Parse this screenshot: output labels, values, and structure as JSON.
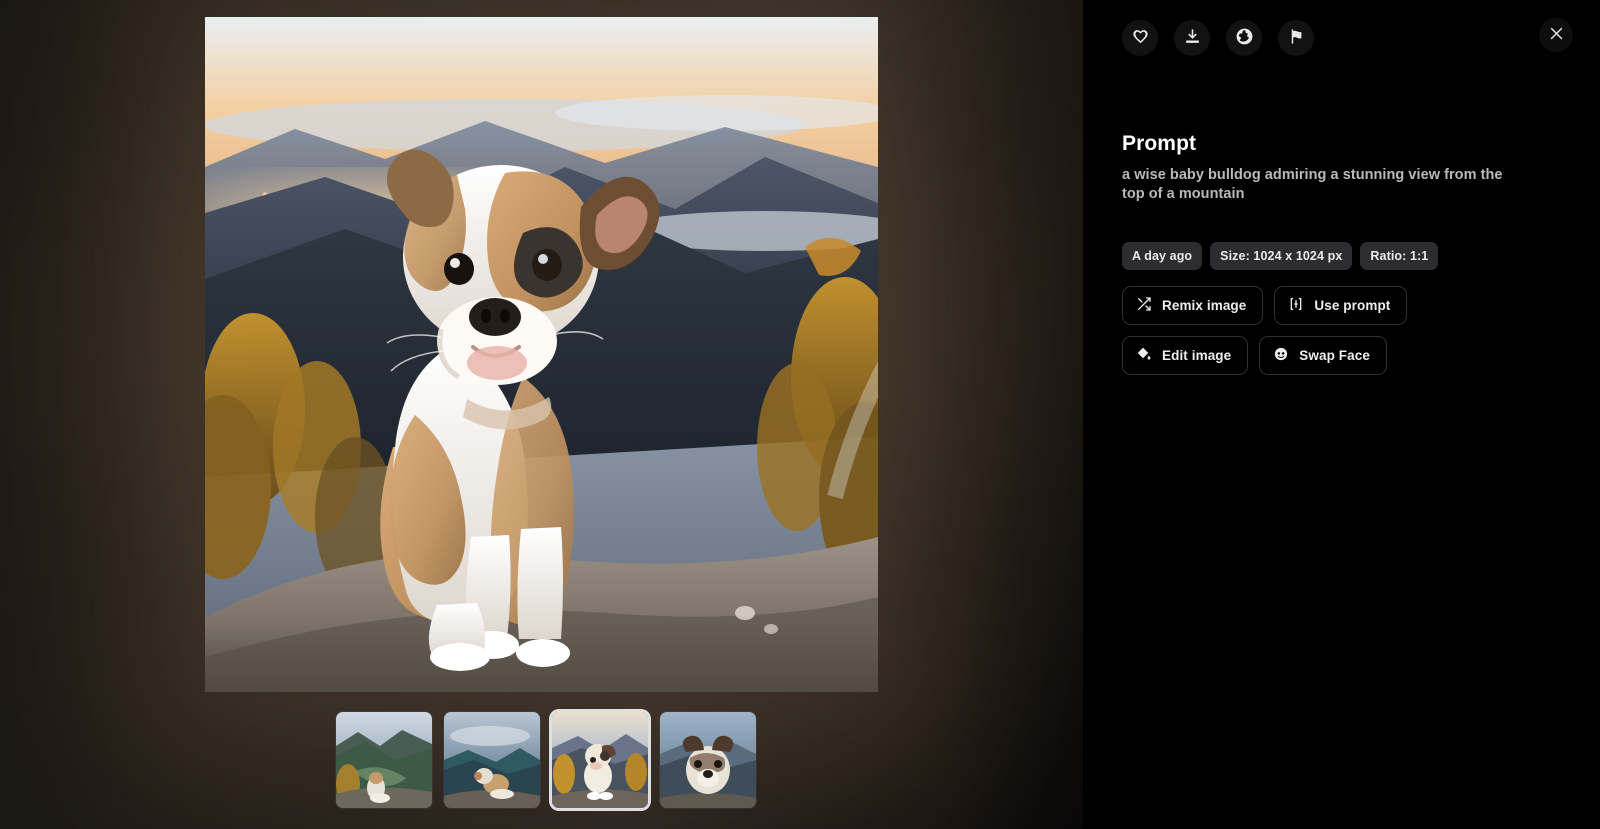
{
  "viewer": {
    "main_image_alt": "a wise baby bulldog sitting on a rocky mountain ledge at sunset",
    "thumbnails": [
      {
        "alt": "bulldog puppy sitting on mountain overlook with green valley",
        "selected": false
      },
      {
        "alt": "bulldog puppy in profile on rock with blue mountain range",
        "selected": false
      },
      {
        "alt": "bulldog puppy standing on rock with autumn trees",
        "selected": true
      },
      {
        "alt": "close up bulldog puppy face against mountain sky",
        "selected": false
      }
    ]
  },
  "toolbar": {
    "buttons": [
      {
        "name": "favorite",
        "icon": "heart-icon",
        "label": "Favorite"
      },
      {
        "name": "download",
        "icon": "download-icon",
        "label": "Download"
      },
      {
        "name": "publish",
        "icon": "globe-icon",
        "label": "Make public"
      },
      {
        "name": "report",
        "icon": "flag-icon",
        "label": "Report"
      }
    ],
    "close": {
      "icon": "close-icon",
      "label": "Close"
    }
  },
  "details": {
    "title": "Prompt",
    "prompt": "a wise baby bulldog admiring a stunning view from the top of a mountain",
    "chips": [
      "A day ago",
      "Size: 1024 x 1024 px",
      "Ratio: 1:1"
    ],
    "actions": [
      {
        "label": "Remix image",
        "icon": "shuffle-icon"
      },
      {
        "label": "Use prompt",
        "icon": "text-cursor-icon"
      },
      {
        "label": "Edit image",
        "icon": "paint-bucket-icon"
      },
      {
        "label": "Swap Face",
        "icon": "face-icon"
      }
    ]
  },
  "colors": {
    "panel_bg": "#000000",
    "viewer_bg": "#241f1a",
    "chip_bg": "#2c2c31",
    "text_primary": "#ffffff",
    "text_secondary": "#b9b9be",
    "border": "#2f2f35"
  }
}
